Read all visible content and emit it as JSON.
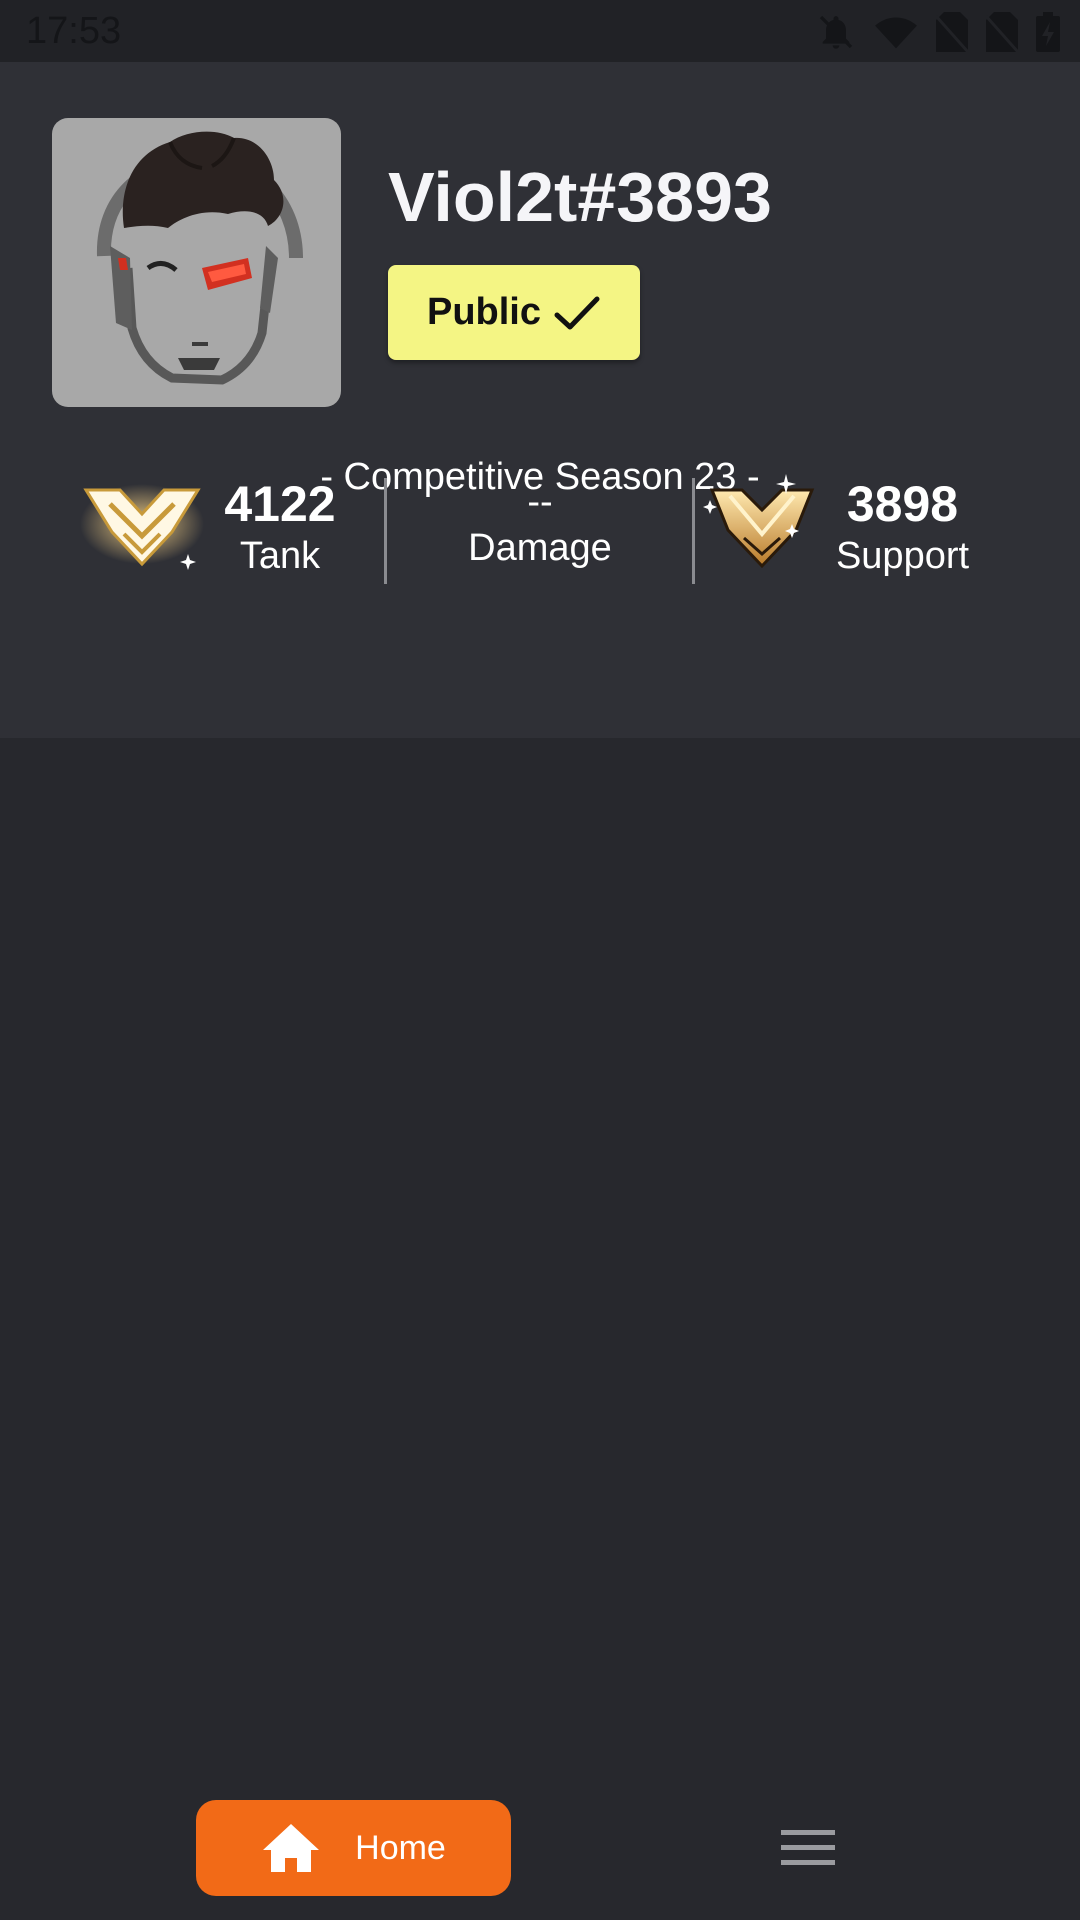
{
  "status_bar": {
    "time": "17:53",
    "icons": [
      "notifications-off-icon",
      "wifi-icon",
      "no-sim-icon",
      "no-sim-icon",
      "battery-charging-icon"
    ]
  },
  "profile": {
    "username": "Viol2t#3893",
    "visibility_label": "Public",
    "visibility_icon": "check-icon",
    "avatar_icon": "hero-portrait-icon"
  },
  "competitive": {
    "season_title": "- Competitive Season 23 -",
    "roles": [
      {
        "name": "Tank",
        "value": "4122",
        "rank_icon": "grandmaster-rank-icon"
      },
      {
        "name": "Damage",
        "value": "--",
        "rank_icon": ""
      },
      {
        "name": "Support",
        "value": "3898",
        "rank_icon": "master-rank-icon"
      }
    ]
  },
  "bottom_nav": {
    "home_label": "Home",
    "home_icon": "home-icon",
    "menu_icon": "menu-icon"
  },
  "colors": {
    "accent": "#f26a17",
    "public_badge": "#f4f584",
    "background": "#27282d",
    "panel": "#2f3036"
  }
}
